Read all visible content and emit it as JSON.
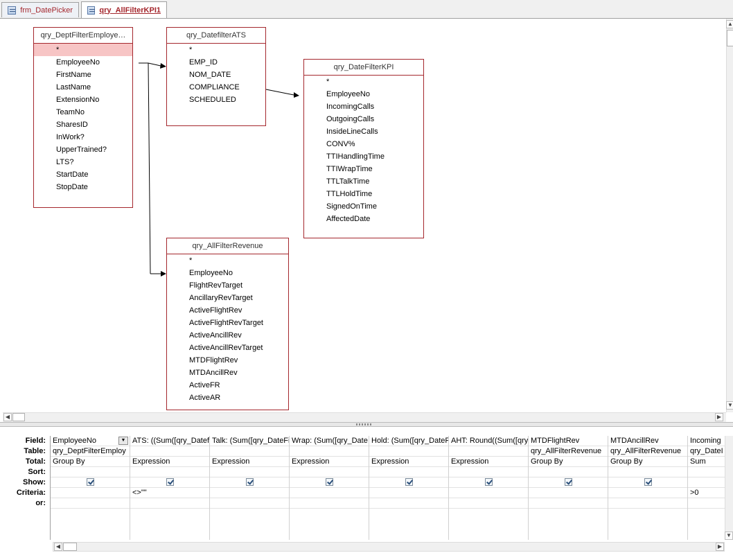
{
  "tabs": [
    {
      "label": "frm_DatePicker"
    },
    {
      "label": "qry_AllFilterKPI1"
    }
  ],
  "tables": {
    "dept": {
      "title": "qry_DeptFilterEmploye…",
      "fields": [
        "*",
        "EmployeeNo",
        "FirstName",
        "LastName",
        "ExtensionNo",
        "TeamNo",
        "SharesID",
        "InWork?",
        "UpperTrained?",
        "LTS?",
        "StartDate",
        "StopDate"
      ]
    },
    "ats": {
      "title": "qry_DatefilterATS",
      "fields": [
        "*",
        "EMP_ID",
        "NOM_DATE",
        "COMPLIANCE",
        "SCHEDULED"
      ]
    },
    "kpi": {
      "title": "qry_DateFilterKPI",
      "fields": [
        "*",
        "EmployeeNo",
        "IncomingCalls",
        "OutgoingCalls",
        "InsideLineCalls",
        "CONV%",
        "TTIHandlingTime",
        "TTIWrapTime",
        "TTLTalkTime",
        "TTLHoldTime",
        "SignedOnTime",
        "AffectedDate"
      ]
    },
    "rev": {
      "title": "qry_AllFilterRevenue",
      "fields": [
        "*",
        "EmployeeNo",
        "FlightRevTarget",
        "AncillaryRevTarget",
        "ActiveFlightRev",
        "ActiveFlightRevTarget",
        "ActiveAncillRev",
        "ActiveAncillRevTarget",
        "MTDFlightRev",
        "MTDAncillRev",
        "ActiveFR",
        "ActiveAR"
      ]
    }
  },
  "grid": {
    "row_labels": [
      "Field:",
      "Table:",
      "Total:",
      "Sort:",
      "Show:",
      "Criteria:",
      "or:"
    ],
    "columns": [
      {
        "field": "EmployeeNo",
        "table": "qry_DeptFilterEmploy",
        "total": "Group By",
        "sort": "",
        "show": true,
        "criteria": "",
        "or": ""
      },
      {
        "field": "ATS: ((Sum([qry_Datefi",
        "table": "",
        "total": "Expression",
        "sort": "",
        "show": true,
        "criteria": "<>\"\"",
        "or": ""
      },
      {
        "field": "Talk: (Sum([qry_DateFi",
        "table": "",
        "total": "Expression",
        "sort": "",
        "show": true,
        "criteria": "",
        "or": ""
      },
      {
        "field": "Wrap: (Sum([qry_Date",
        "table": "",
        "total": "Expression",
        "sort": "",
        "show": true,
        "criteria": "",
        "or": ""
      },
      {
        "field": "Hold: (Sum([qry_DateF",
        "table": "",
        "total": "Expression",
        "sort": "",
        "show": true,
        "criteria": "",
        "or": ""
      },
      {
        "field": "AHT: Round((Sum([qry",
        "table": "",
        "total": "Expression",
        "sort": "",
        "show": true,
        "criteria": "",
        "or": ""
      },
      {
        "field": "MTDFlightRev",
        "table": "qry_AllFilterRevenue",
        "total": "Group By",
        "sort": "",
        "show": true,
        "criteria": "",
        "or": ""
      },
      {
        "field": "MTDAncillRev",
        "table": "qry_AllFilterRevenue",
        "total": "Group By",
        "sort": "",
        "show": true,
        "criteria": "",
        "or": ""
      },
      {
        "field": "Incoming",
        "table": "qry_DateI",
        "total": "Sum",
        "sort": "",
        "show": false,
        "criteria": ">0",
        "or": ""
      }
    ]
  }
}
